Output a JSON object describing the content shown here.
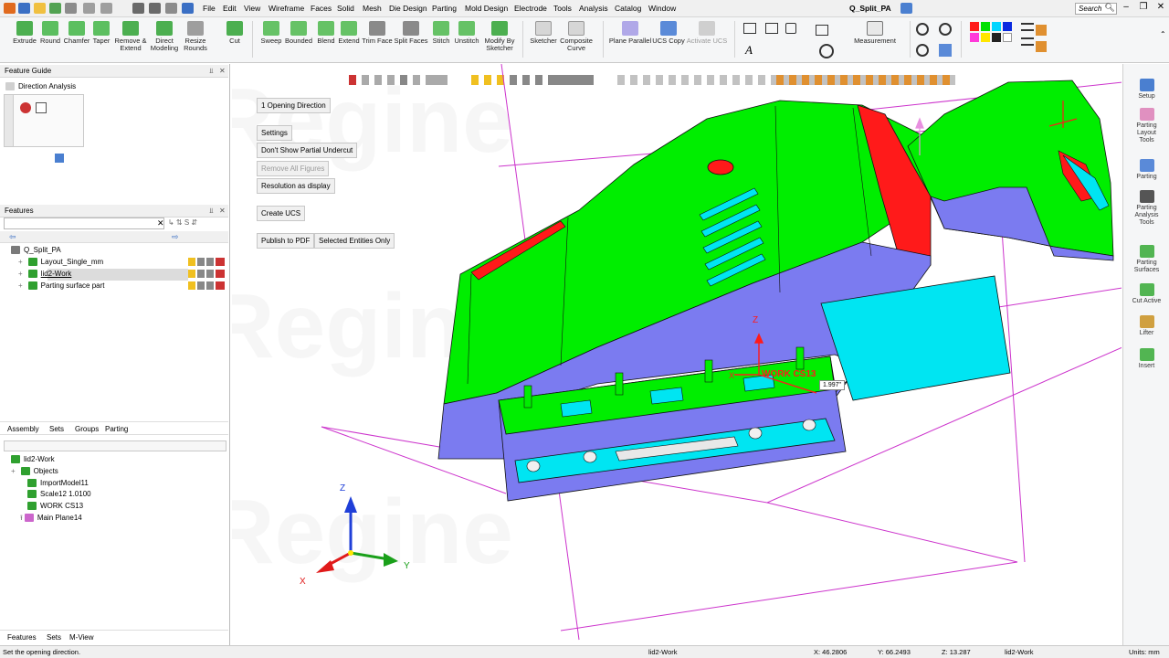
{
  "title_bar": {
    "menu": [
      "File",
      "Edit",
      "View",
      "Wireframe",
      "Faces",
      "Solid",
      "Mesh",
      "Die Design",
      "Parting",
      "Mold Design",
      "Electrode",
      "Tools",
      "Analysis",
      "Catalog",
      "Window"
    ],
    "doc_title": "Q_Split_PA",
    "search_placeholder": "Search"
  },
  "ribbon": {
    "buttons": [
      {
        "label": "Extrude",
        "icon": "extrude-icon"
      },
      {
        "label": "Round",
        "icon": "round-icon"
      },
      {
        "label": "Chamfer",
        "icon": "chamfer-icon"
      },
      {
        "label": "Taper",
        "icon": "taper-icon"
      },
      {
        "label": "Remove &\nExtend",
        "icon": "remove-extend-icon"
      },
      {
        "label": "Direct\nModeling",
        "icon": "direct-modeling-icon"
      },
      {
        "label": "Resize\nRounds",
        "icon": "resize-rounds-icon"
      },
      {
        "label": "Cut",
        "icon": "cut-icon"
      },
      {
        "label": "Sweep",
        "icon": "sweep-icon"
      },
      {
        "label": "Bounded",
        "icon": "bounded-icon"
      },
      {
        "label": "Blend",
        "icon": "blend-icon"
      },
      {
        "label": "Extend",
        "icon": "extend-icon"
      },
      {
        "label": "Trim Face",
        "icon": "trim-face-icon"
      },
      {
        "label": "Split Faces",
        "icon": "split-faces-icon"
      },
      {
        "label": "Stitch",
        "icon": "stitch-icon"
      },
      {
        "label": "Unstitch",
        "icon": "unstitch-icon"
      },
      {
        "label": "Modify By\nSketcher",
        "icon": "modify-sketcher-icon"
      },
      {
        "label": "Sketcher",
        "icon": "sketcher-icon"
      },
      {
        "label": "Composite\nCurve",
        "icon": "composite-curve-icon"
      },
      {
        "label": "Plane Parallel",
        "icon": "plane-parallel-icon"
      },
      {
        "label": "UCS Copy",
        "icon": "ucs-copy-icon"
      },
      {
        "label": "Activate UCS",
        "icon": "activate-ucs-icon"
      },
      {
        "label": "Measurement",
        "icon": "measurement-icon"
      }
    ]
  },
  "feature_guide": {
    "title": "Feature Guide",
    "item": "Direction Analysis"
  },
  "features_panel": {
    "title": "Features",
    "root": "Q_Split_PA",
    "items": [
      "Layout_Single_mm",
      "lid2-Work",
      "Parting surface part"
    ],
    "tabs": [
      "Assembly",
      "Sets",
      "Groups",
      "Parting"
    ]
  },
  "tree_panel": {
    "root": "lid2-Work",
    "items": [
      "Objects",
      "ImportModel11",
      "Scale12  1.0100",
      "WORK CS13",
      "Main Plane14"
    ],
    "bottom_tabs": [
      "Features",
      "Sets",
      "M-View"
    ]
  },
  "viewport": {
    "buttons": {
      "opening_direction": "1 Opening Direction",
      "settings": "Settings",
      "dont_show": "Don't Show Partial Undercut",
      "remove_all": "Remove All Figures",
      "resolution": "Resolution as display",
      "create_ucs": "Create UCS",
      "publish_pdf": "Publish to PDF",
      "selected_entities": "Selected Entities Only"
    },
    "watermark": "Ooi Regine",
    "axis_labels": {
      "x": "X",
      "y": "Y",
      "z": "Z"
    },
    "model_label": "WORK CS13",
    "tooltip_value": "1.997\""
  },
  "right_panel": {
    "buttons": [
      {
        "label": "Setup",
        "icon": "setup-icon"
      },
      {
        "label": "Parting\nLayout\nTools",
        "icon": "parting-layout-icon"
      },
      {
        "label": "Parting",
        "icon": "parting-icon"
      },
      {
        "label": "Parting\nAnalysis\nTools",
        "icon": "parting-analysis-icon"
      },
      {
        "label": "Parting\nSurfaces",
        "icon": "parting-surfaces-icon"
      },
      {
        "label": "Cut Active",
        "icon": "cut-active-icon"
      },
      {
        "label": "Lifter",
        "icon": "lifter-icon"
      },
      {
        "label": "Insert",
        "icon": "insert-icon"
      }
    ]
  },
  "status_bar": {
    "message": "Set the opening direction.",
    "active_object": "lid2-Work",
    "x": "X: 46.2806",
    "y": "Y: 66.2493",
    "z": "Z: 13.287",
    "object2": "lid2-Work",
    "units": "Units: mm"
  },
  "colors": {
    "model_green": "#00ee00",
    "model_blue": "#7b7bf0",
    "model_cyan": "#00e5f2",
    "model_red": "#ff1a1a",
    "plane_magenta": "#cc33cc"
  }
}
